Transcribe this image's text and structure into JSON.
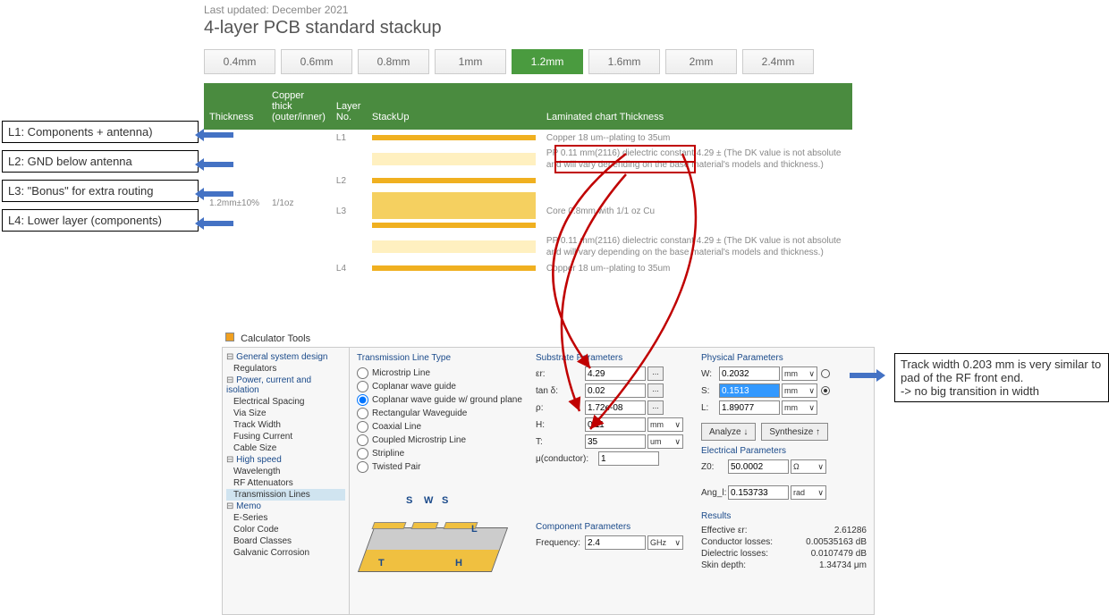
{
  "stackup": {
    "last_updated": "Last updated: December 2021",
    "title": "4-layer PCB standard stackup",
    "tabs": [
      "0.4mm",
      "0.6mm",
      "0.8mm",
      "1mm",
      "1.2mm",
      "1.6mm",
      "2mm",
      "2.4mm"
    ],
    "active_tab": "1.2mm",
    "headers": {
      "thickness": "Thickness",
      "copper": "Copper thick (outer/inner)",
      "layer": "Layer No.",
      "stack": "StackUp",
      "laminated": "Laminated chart Thickness"
    },
    "thickness_val": "1.2mm±10%",
    "copper_val": "1/1oz",
    "layers": [
      "L1",
      "L2",
      "L3",
      "L4"
    ],
    "laminated_lines": [
      "Copper 18 um--plating to 35um",
      "PP 0.11 mm(2116) dielectric constant 4.29 ± (The DK value is not absolute and will vary depending on the base material's models and thickness.)",
      "Core 0.8mm with 1/1 oz Cu",
      "PP 0.11 mm(2116) dielectric constant 4.29 ± (The DK value is not absolute and will vary depending on the base material's models and thickness.)",
      "Copper 18 um--plating to 35um"
    ]
  },
  "left_annos": [
    "L1: Components + antenna)",
    "L2: GND below antenna",
    "L3: \"Bonus\" for extra routing",
    "L4: Lower layer (components)"
  ],
  "right_anno": "Track width 0.203 mm is very similar to pad of the RF front end.\n-> no big transition in width",
  "calc": {
    "title": "Calculator Tools",
    "tree": {
      "g1": "General system design",
      "g1_items": [
        "Regulators"
      ],
      "g2": "Power, current and isolation",
      "g2_items": [
        "Electrical Spacing",
        "Via Size",
        "Track Width",
        "Fusing Current",
        "Cable Size"
      ],
      "g3": "High speed",
      "g3_items": [
        "Wavelength",
        "RF Attenuators",
        "Transmission Lines"
      ],
      "g4": "Memo",
      "g4_items": [
        "E-Series",
        "Color Code",
        "Board Classes",
        "Galvanic Corrosion"
      ],
      "selected": "Transmission Lines"
    },
    "tx": {
      "title": "Transmission Line Type",
      "options": [
        "Microstrip Line",
        "Coplanar wave guide",
        "Coplanar wave guide w/ ground plane",
        "Rectangular Waveguide",
        "Coaxial Line",
        "Coupled Microstrip Line",
        "Stripline",
        "Twisted Pair"
      ],
      "selected": "Coplanar wave guide w/ ground plane"
    },
    "substrate": {
      "title": "Substrate Parameters",
      "er_label": "εr:",
      "er": "4.29",
      "tand_label": "tan δ:",
      "tand": "0.02",
      "rho_label": "ρ:",
      "rho": "1.72e-08",
      "H_label": "H:",
      "H": "0.11",
      "H_unit": "mm",
      "T_label": "T:",
      "T": "35",
      "T_unit": "um",
      "mu_label": "μ(conductor):",
      "mu": "1"
    },
    "component": {
      "title": "Component Parameters",
      "freq_label": "Frequency:",
      "freq": "2.4",
      "freq_unit": "GHz"
    },
    "physical": {
      "title": "Physical Parameters",
      "W_label": "W:",
      "W": "0.2032",
      "W_unit": "mm",
      "S_label": "S:",
      "S": "0.1513",
      "S_unit": "mm",
      "L_label": "L:",
      "L": "1.89077",
      "L_unit": "mm"
    },
    "buttons": {
      "analyze": "Analyze",
      "synth": "Synthesize"
    },
    "electrical": {
      "title": "Electrical Parameters",
      "Z0_label": "Z0:",
      "Z0": "50.0002",
      "Z0_unit": "Ω",
      "Ang_label": "Ang_l:",
      "Ang": "0.153733",
      "Ang_unit": "rad"
    },
    "results": {
      "title": "Results",
      "eff_er_label": "Effective εr:",
      "eff_er": "2.61286",
      "cond_label": "Conductor losses:",
      "cond": "0.00535163 dB",
      "diel_label": "Dielectric losses:",
      "diel": "0.0107479 dB",
      "skin_label": "Skin depth:",
      "skin": "1.34734 μm"
    },
    "diagram": {
      "S": "S",
      "W": "W",
      "T": "T",
      "H": "H",
      "L": "L"
    }
  }
}
